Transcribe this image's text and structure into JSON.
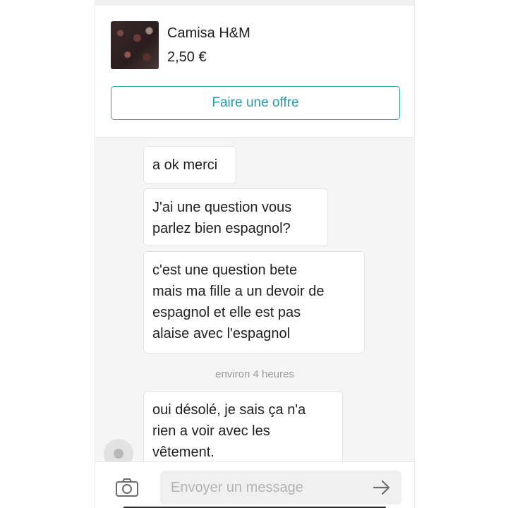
{
  "product": {
    "title": "Camisa H&M",
    "price": "2,50 €",
    "offer_label": "Faire une offre"
  },
  "messages": [
    {
      "text": "a ok merci"
    },
    {
      "text": "J'ai une question vous\nparlez bien espagnol?"
    },
    {
      "text": "c'est une question bete\nmais ma fille a un devoir de\nespagnol et elle est pas\nalaise avec l'espagnol"
    },
    {
      "text": "oui désolé, je sais ça n'a\nrien a voir avec les\nvêtement."
    }
  ],
  "timestamp": "environ 4 heures",
  "composer": {
    "placeholder": "Envoyer un message",
    "camera_icon": "camera-icon",
    "send_icon": "arrow-right-icon"
  },
  "colors": {
    "accent": "#2aa0ac",
    "background": "#f5f5f5",
    "bubble": "#ffffff",
    "muted_text": "#9a9a9a"
  }
}
